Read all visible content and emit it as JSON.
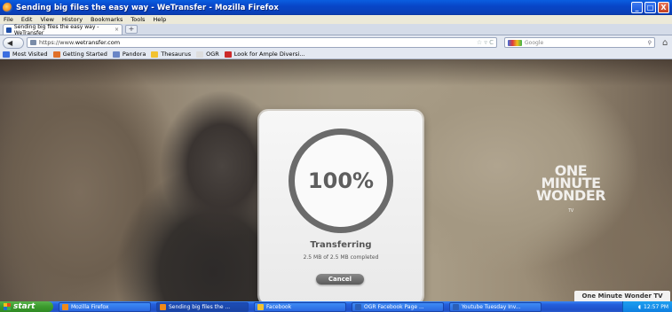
{
  "window": {
    "title": "Sending big files the easy way - WeTransfer - Mozilla Firefox",
    "controls": [
      "_",
      "□",
      "X"
    ]
  },
  "menu": [
    "File",
    "Edit",
    "View",
    "History",
    "Bookmarks",
    "Tools",
    "Help"
  ],
  "tab": {
    "label": "Sending big files the easy way - WeTransfer",
    "close": "×",
    "new_tab": "+"
  },
  "nav": {
    "back": "◀",
    "url_prefix": "https://www.",
    "url_host": "wetransfer.com",
    "star": "☆ ▿ C",
    "search_placeholder": "Google"
  },
  "bookmarks": [
    {
      "label": "Most Visited",
      "color": "#3b6ee0"
    },
    {
      "label": "Getting Started",
      "color": "#e0702a"
    },
    {
      "label": "Pandora",
      "color": "#6a86c6"
    },
    {
      "label": "Thesaurus",
      "color": "#f2c230"
    },
    {
      "label": "OGR",
      "color": "#dddddd"
    },
    {
      "label": "Look for Ample Diversi...",
      "color": "#cc2a2a"
    }
  ],
  "transfer": {
    "percent": "100%",
    "progress": 1.0,
    "status": "Transferring",
    "detail": "2.5 MB of 2.5 MB completed",
    "cancel": "Cancel"
  },
  "brand": {
    "logo_lines": [
      "ONE",
      "MINUTE",
      "WONDER"
    ],
    "logo_tv": "TV",
    "tag": "One Minute Wonder TV"
  },
  "taskbar": {
    "start": "start",
    "items": [
      {
        "label": "Mozilla Firefox",
        "color": "#f08a1a",
        "active": false
      },
      {
        "label": "Sending big files the ...",
        "color": "#f08a1a",
        "active": true
      },
      {
        "label": "Facebook",
        "color": "#f2c230",
        "active": false
      },
      {
        "label": "OGR Facebook Page ...",
        "color": "#2b5fb8",
        "active": false
      },
      {
        "label": "Youtube Tuesday Inv...",
        "color": "#2b5fb8",
        "active": false
      }
    ],
    "clock": "12:57 PM"
  }
}
